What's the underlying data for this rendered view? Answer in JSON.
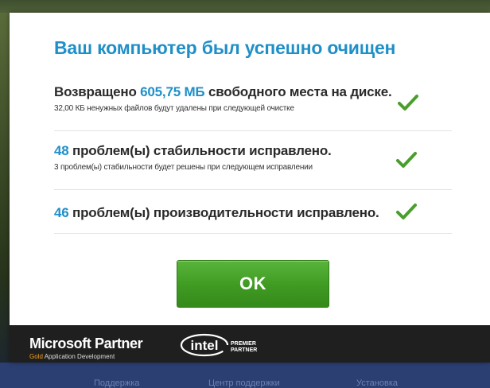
{
  "dialog": {
    "title": "Ваш компьютер был успешно очищен",
    "rows": [
      {
        "pre": "Возвращено ",
        "value": "605,75 МБ",
        "post": " свободного места на диске.",
        "sub": "32,00 КБ ненужных файлов будут удалены при следующей очистке"
      },
      {
        "pre": "",
        "value": "48",
        "post": " проблем(ы) стабильности исправлено.",
        "sub": "3 проблем(ы) стабильности будет решены при следующем исправлении"
      },
      {
        "pre": "",
        "value": "46",
        "post": " проблем(ы) производительности исправлено.",
        "sub": ""
      }
    ],
    "ok_label": "OK"
  },
  "footer": {
    "ms_partner": "Microsoft Partner",
    "ms_gold": "Gold",
    "ms_sub": " Application Development",
    "intel": "intel",
    "premier_line1": "PREMIER",
    "premier_line2": "PARTNER"
  },
  "background_nav": [
    "Поддержка",
    "Центр поддержки",
    "Установка"
  ],
  "colors": {
    "accent": "#1f8fc8",
    "check": "#4a9e2c",
    "button": "#3f9a22",
    "footer": "#1f1f1f"
  }
}
